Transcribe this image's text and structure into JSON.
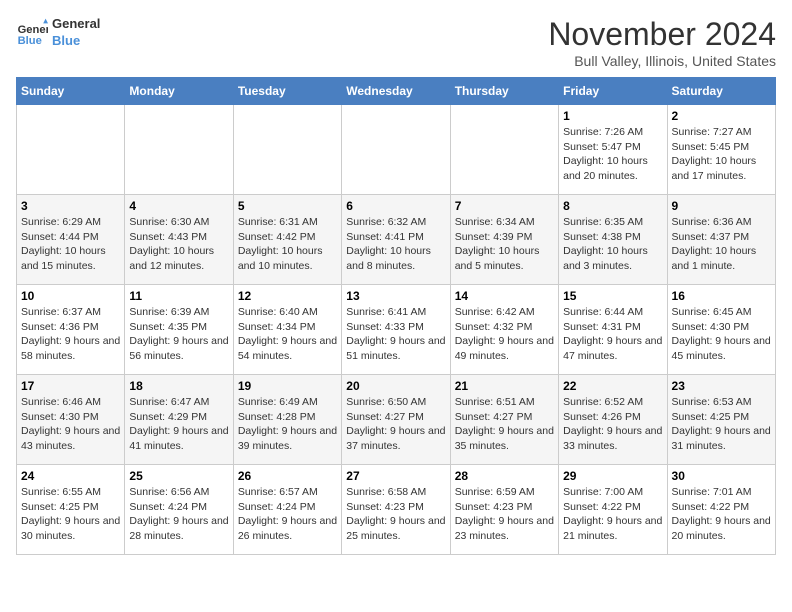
{
  "logo": {
    "line1": "General",
    "line2": "Blue"
  },
  "title": "November 2024",
  "location": "Bull Valley, Illinois, United States",
  "weekdays": [
    "Sunday",
    "Monday",
    "Tuesday",
    "Wednesday",
    "Thursday",
    "Friday",
    "Saturday"
  ],
  "weeks": [
    [
      {
        "day": "",
        "info": ""
      },
      {
        "day": "",
        "info": ""
      },
      {
        "day": "",
        "info": ""
      },
      {
        "day": "",
        "info": ""
      },
      {
        "day": "",
        "info": ""
      },
      {
        "day": "1",
        "info": "Sunrise: 7:26 AM\nSunset: 5:47 PM\nDaylight: 10 hours and 20 minutes."
      },
      {
        "day": "2",
        "info": "Sunrise: 7:27 AM\nSunset: 5:45 PM\nDaylight: 10 hours and 17 minutes."
      }
    ],
    [
      {
        "day": "3",
        "info": "Sunrise: 6:29 AM\nSunset: 4:44 PM\nDaylight: 10 hours and 15 minutes."
      },
      {
        "day": "4",
        "info": "Sunrise: 6:30 AM\nSunset: 4:43 PM\nDaylight: 10 hours and 12 minutes."
      },
      {
        "day": "5",
        "info": "Sunrise: 6:31 AM\nSunset: 4:42 PM\nDaylight: 10 hours and 10 minutes."
      },
      {
        "day": "6",
        "info": "Sunrise: 6:32 AM\nSunset: 4:41 PM\nDaylight: 10 hours and 8 minutes."
      },
      {
        "day": "7",
        "info": "Sunrise: 6:34 AM\nSunset: 4:39 PM\nDaylight: 10 hours and 5 minutes."
      },
      {
        "day": "8",
        "info": "Sunrise: 6:35 AM\nSunset: 4:38 PM\nDaylight: 10 hours and 3 minutes."
      },
      {
        "day": "9",
        "info": "Sunrise: 6:36 AM\nSunset: 4:37 PM\nDaylight: 10 hours and 1 minute."
      }
    ],
    [
      {
        "day": "10",
        "info": "Sunrise: 6:37 AM\nSunset: 4:36 PM\nDaylight: 9 hours and 58 minutes."
      },
      {
        "day": "11",
        "info": "Sunrise: 6:39 AM\nSunset: 4:35 PM\nDaylight: 9 hours and 56 minutes."
      },
      {
        "day": "12",
        "info": "Sunrise: 6:40 AM\nSunset: 4:34 PM\nDaylight: 9 hours and 54 minutes."
      },
      {
        "day": "13",
        "info": "Sunrise: 6:41 AM\nSunset: 4:33 PM\nDaylight: 9 hours and 51 minutes."
      },
      {
        "day": "14",
        "info": "Sunrise: 6:42 AM\nSunset: 4:32 PM\nDaylight: 9 hours and 49 minutes."
      },
      {
        "day": "15",
        "info": "Sunrise: 6:44 AM\nSunset: 4:31 PM\nDaylight: 9 hours and 47 minutes."
      },
      {
        "day": "16",
        "info": "Sunrise: 6:45 AM\nSunset: 4:30 PM\nDaylight: 9 hours and 45 minutes."
      }
    ],
    [
      {
        "day": "17",
        "info": "Sunrise: 6:46 AM\nSunset: 4:30 PM\nDaylight: 9 hours and 43 minutes."
      },
      {
        "day": "18",
        "info": "Sunrise: 6:47 AM\nSunset: 4:29 PM\nDaylight: 9 hours and 41 minutes."
      },
      {
        "day": "19",
        "info": "Sunrise: 6:49 AM\nSunset: 4:28 PM\nDaylight: 9 hours and 39 minutes."
      },
      {
        "day": "20",
        "info": "Sunrise: 6:50 AM\nSunset: 4:27 PM\nDaylight: 9 hours and 37 minutes."
      },
      {
        "day": "21",
        "info": "Sunrise: 6:51 AM\nSunset: 4:27 PM\nDaylight: 9 hours and 35 minutes."
      },
      {
        "day": "22",
        "info": "Sunrise: 6:52 AM\nSunset: 4:26 PM\nDaylight: 9 hours and 33 minutes."
      },
      {
        "day": "23",
        "info": "Sunrise: 6:53 AM\nSunset: 4:25 PM\nDaylight: 9 hours and 31 minutes."
      }
    ],
    [
      {
        "day": "24",
        "info": "Sunrise: 6:55 AM\nSunset: 4:25 PM\nDaylight: 9 hours and 30 minutes."
      },
      {
        "day": "25",
        "info": "Sunrise: 6:56 AM\nSunset: 4:24 PM\nDaylight: 9 hours and 28 minutes."
      },
      {
        "day": "26",
        "info": "Sunrise: 6:57 AM\nSunset: 4:24 PM\nDaylight: 9 hours and 26 minutes."
      },
      {
        "day": "27",
        "info": "Sunrise: 6:58 AM\nSunset: 4:23 PM\nDaylight: 9 hours and 25 minutes."
      },
      {
        "day": "28",
        "info": "Sunrise: 6:59 AM\nSunset: 4:23 PM\nDaylight: 9 hours and 23 minutes."
      },
      {
        "day": "29",
        "info": "Sunrise: 7:00 AM\nSunset: 4:22 PM\nDaylight: 9 hours and 21 minutes."
      },
      {
        "day": "30",
        "info": "Sunrise: 7:01 AM\nSunset: 4:22 PM\nDaylight: 9 hours and 20 minutes."
      }
    ]
  ]
}
